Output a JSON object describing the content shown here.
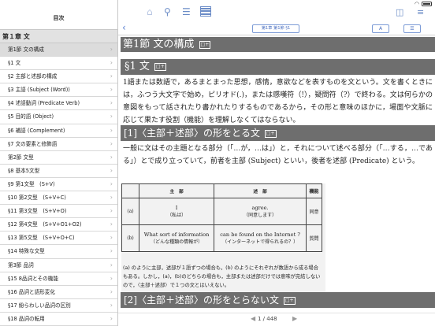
{
  "sidebar": {
    "title": "目次",
    "chapter": "第１章 文",
    "items": [
      "第1節 文の構成",
      "§1 文",
      "§2 主部と述部の構成",
      "§3 主語 (Subject (Word))",
      "§4 述語動詞 (Predicate Verb)",
      "§5 目的語 (Object)",
      "§6 補語 (Complement)",
      "§7 文の要素と修飾語",
      "第2節 文型",
      "§8 基本5文型",
      "§9 第1文型　(S+V)",
      "§10 第2文型　(S+V+C)",
      "§11 第3文型　(S+V+O)",
      "§12 第4文型　(S+V+O1+O2)",
      "§13 第5文型　(S+V+O+C)",
      "§14 特殊な文型",
      "第3節 品詞",
      "§15 8品詞とその機能",
      "§16 品詞と語形変化",
      "§17 紛らわしい品詞の区別",
      "§18 品詞の転用"
    ]
  },
  "toolbar": {
    "location_label": "第1章 第1節 §1",
    "font_label": "A",
    "note_label": "☰"
  },
  "content": {
    "h1": "第1節 文の構成",
    "h1_badge": "□+",
    "h2": "§1 文",
    "h2_badge": "□+",
    "p1": "1語または数語で，あるまとまった思想，感情，意欲などを表すものを文という。文を書くときには，ふつう大文字で始め，ピリオド(.)，または感嘆符（!），疑問符（?）で終わる。文は何らかの意図をもって話されたり書かれたりするものであるから，その形と意味のほかに，場面や文脈に応じて果たす役割（機能）を理解しなくてはならない。",
    "h3": "[1]〈主部＋述部〉の形をとる文",
    "h3_badge": "□+",
    "p2": "一般に文はその主題となる部分（「…が，…は」）と，それについて述べる部分（「…する，…である」）とで成り立っていて，前者を主部 (Subject) といい，後者を述部 (Predicate) という。",
    "table": {
      "col_subject": "主　部",
      "col_predicate": "述　部",
      "col_function": "機能",
      "rows": [
        {
          "label": "(a)",
          "subject": "I",
          "subject_jp": "（私は）",
          "predicate": "agree.",
          "predicate_jp": "（同意します）",
          "function": "同意"
        },
        {
          "label": "(b)",
          "subject": "What sort of information",
          "subject_jp": "（どんな種類の情報が）",
          "predicate": "can be found on the Internet ?",
          "predicate_jp": "（インターネットで得られるの？）",
          "function": "質問"
        }
      ]
    },
    "note": "(a) のように主部，述部が１語ずつの場合も，(b) のようにそれぞれが数語から成る場合もある。しかし，(a)，(b)のどちらの場合も，主部または述部だけでは意味が完結しないので，〈主部＋述部〉で１つの文とはいえない。",
    "h4": "[2]〈主部＋述部〉の形をとらない文",
    "h4_badge": "□+"
  },
  "footer": {
    "page": "1 / 448",
    "prev": "◀",
    "next": "▶"
  }
}
